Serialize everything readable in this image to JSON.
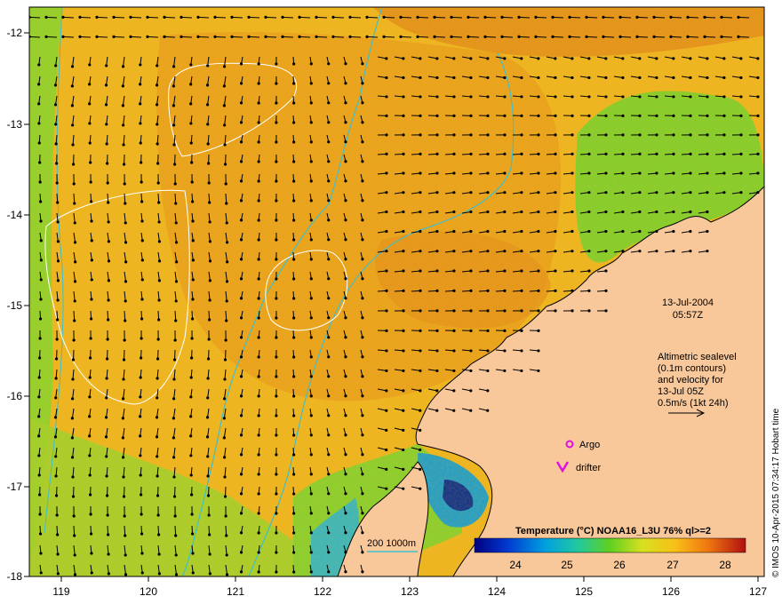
{
  "map": {
    "lon_ticks": [
      "119",
      "120",
      "121",
      "122",
      "123",
      "124",
      "125",
      "126",
      "127"
    ],
    "lat_ticks": [
      "-12",
      "-13",
      "-14",
      "-15",
      "-16",
      "-17",
      "-18"
    ],
    "colors": {
      "land": "#f9c89a",
      "sea_warm": "#e9a21a",
      "sea_mid": "#f0c020",
      "sea_cool": "#7fcf2a",
      "sea_cold": "#1c9ec9",
      "isobath": "#3fbfcc",
      "sealevel_contour": "#ffffff",
      "vector": "#000000",
      "marker": "#e010e0"
    }
  },
  "annotations": {
    "date": "13-Jul-2004",
    "time": "05:57Z",
    "alt_lines": [
      "Altimetric sealevel",
      "(0.1m contours)",
      "and velocity for",
      "13-Jul 05Z",
      "0.5m/s (1kt 24h)"
    ]
  },
  "legend": {
    "argo_label": "Argo",
    "drifter_label": "drifter",
    "isobath_label": "200  1000m"
  },
  "colorbar": {
    "title": "Temperature (°C) NOAA16_L3U 76% ql>=2",
    "tick_labels": [
      "24",
      "25",
      "26",
      "27",
      "28"
    ]
  },
  "credit": "© IMOS 10-Apr-2015 07:34:17 Hobart time"
}
